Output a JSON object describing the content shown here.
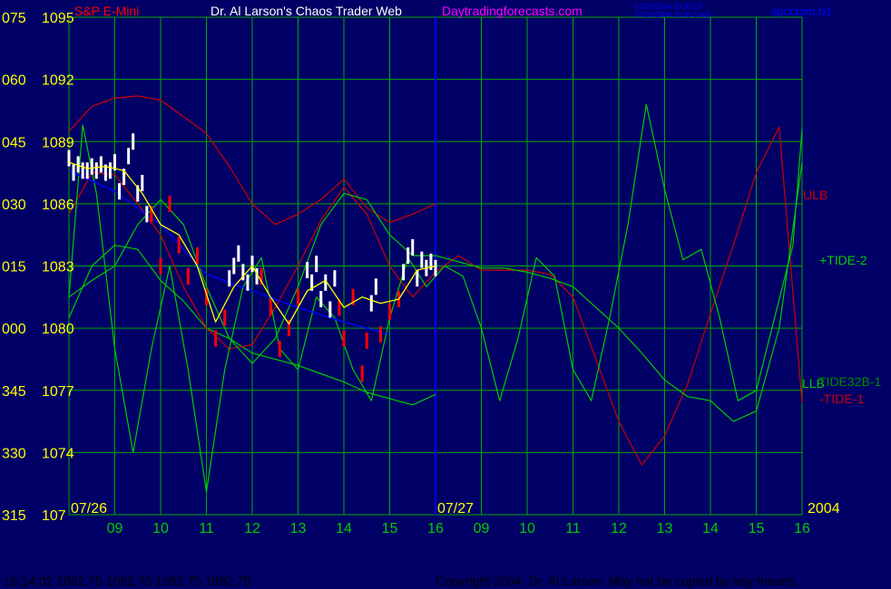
{
  "header": {
    "instrument": "S&P E-Mini",
    "publisher": "Dr. Al Larson's Chaos Trader Web",
    "website": "Daytradingforecasts.com",
    "timestamp_ut": "07/26/2004 20:30 UT",
    "timestamp_local": "07/26/2004 15:30 Local",
    "file_name": "spcctom.txt"
  },
  "footer": {
    "quote": "16:14:02  1082.75 1082.75 1082.75 1082.75",
    "copyright": "Copyright 2004, Dr. Al Larson. May not be copied by any means."
  },
  "colors": {
    "background": "#000066",
    "grid": "#00aa00",
    "price_up": "#ffffff",
    "price_down": "#ff0000",
    "average": "#ffff00",
    "trend": "#0000ff",
    "tide_green": "#00cc00",
    "tide_red": "#cc0000",
    "label_yellow": "#ffff00",
    "label_magenta": "#ff00ff",
    "label_blue": "#0000ff"
  },
  "chart_data": {
    "type": "line",
    "price_axis": {
      "ticks": [
        1071,
        1074,
        1077,
        1080,
        1083,
        1086,
        1089,
        1092,
        1095
      ],
      "labels": [
        "107",
        "1074",
        "1077",
        "1080",
        "1083",
        "1086",
        "1089",
        "1092",
        "1095"
      ],
      "range": [
        1071,
        1095
      ]
    },
    "angle_axis": {
      "labels": [
        "315",
        "330",
        "345",
        "000",
        "015",
        "030",
        "045",
        "060",
        "075"
      ]
    },
    "x_axis": {
      "hour_labels": [
        "09",
        "10",
        "11",
        "12",
        "13",
        "14",
        "15",
        "16",
        "09",
        "10",
        "11",
        "12",
        "13",
        "14",
        "15",
        "16"
      ],
      "date_labels": [
        "07/26",
        "07/27"
      ],
      "year_label": "2004",
      "range": [
        0,
        16
      ]
    },
    "grid": true,
    "series_labels": [
      "ULB",
      "+TIDE-2",
      "LLB",
      "TIDE32B-1",
      "-TIDE-1"
    ],
    "series": [
      {
        "key": "ulb",
        "x": [
          0,
          0.5,
          1,
          1.5,
          2,
          2.5,
          3,
          3.5,
          4,
          4.5,
          5,
          5.5,
          6,
          6.5,
          7,
          7.5,
          8
        ],
        "values": [
          1089.5,
          1090.7,
          1091.1,
          1091.2,
          1091,
          1090.2,
          1089.4,
          1087.8,
          1086,
          1085,
          1085.5,
          1086.2,
          1087.2,
          1085.8,
          1085.1,
          1085.5,
          1086
        ]
      },
      {
        "key": "llb",
        "x": [
          0,
          0.5,
          1,
          1.5,
          2,
          2.5,
          3,
          3.5,
          4,
          4.5,
          5,
          5.5,
          6,
          6.5,
          7,
          7.5,
          8
        ],
        "values": [
          1080.5,
          1083,
          1084,
          1083.8,
          1082.3,
          1081.3,
          1080,
          1079.5,
          1078.8,
          1078.5,
          1078.2,
          1077.8,
          1077.4,
          1076.9,
          1076.6,
          1076.3,
          1076.8
        ]
      },
      {
        "key": "tide_red",
        "x": [
          0,
          0.5,
          1,
          1.5,
          2,
          2.5,
          3,
          3.5,
          4,
          4.5,
          5,
          5.5,
          6,
          6.5,
          7,
          7.5,
          8,
          8.5,
          9,
          9.5,
          10,
          10.5,
          11,
          11.5,
          12,
          12.5,
          13,
          13.5,
          14,
          14.5,
          15,
          15.5,
          16
        ],
        "values": [
          1085.5,
          1087.5,
          1087.4,
          1086,
          1084.5,
          1082,
          1080,
          1079,
          1079.2,
          1081,
          1083,
          1085.2,
          1086.8,
          1085.5,
          1083,
          1081.5,
          1082.7,
          1083.5,
          1082.8,
          1082.8,
          1082.8,
          1082.6,
          1081.5,
          1078.5,
          1075.5,
          1073.4,
          1074.8,
          1077.3,
          1080.7,
          1084,
          1087.5,
          1089.7,
          1076.4
        ]
      },
      {
        "key": "tide_green",
        "x": [
          0,
          0.3,
          0.6,
          1,
          1.4,
          1.8,
          2.2,
          2.6,
          3,
          3.4,
          3.8,
          4.2,
          4.6,
          5,
          5.4,
          5.8,
          6.2,
          6.6,
          7,
          7.4,
          7.8,
          8.2,
          8.6,
          9,
          9.4,
          9.8,
          10.2,
          10.6,
          11,
          11.4,
          11.8,
          12.2,
          12.6,
          13,
          13.4,
          13.8,
          14.2,
          14.6,
          15,
          15.4,
          15.8,
          16
        ],
        "values": [
          1081.5,
          1089.8,
          1086.5,
          1079,
          1074,
          1079,
          1083,
          1078,
          1072.1,
          1078,
          1082,
          1083.4,
          1079,
          1078,
          1081.5,
          1080.5,
          1078,
          1076.5,
          1080.5,
          1083.4,
          1082,
          1083,
          1082.5,
          1080,
          1076.5,
          1079.5,
          1083.4,
          1082.5,
          1078,
          1076.5,
          1080.5,
          1085,
          1090.8,
          1086.7,
          1083.3,
          1083.8,
          1080.5,
          1076.5,
          1077,
          1080.5,
          1084,
          1089.6
        ]
      },
      {
        "key": "tide32",
        "x": [
          0,
          0.5,
          1,
          1.5,
          2,
          2.5,
          3,
          3.5,
          4,
          4.5,
          5,
          5.5,
          6,
          6.5,
          7,
          7.5,
          8,
          8.5,
          9,
          9.5,
          10,
          10.5,
          11,
          11.5,
          12,
          12.5,
          13,
          13.5,
          14,
          14.5,
          15,
          15.5,
          16
        ],
        "values": [
          1081.5,
          1082.3,
          1083,
          1085,
          1086.2,
          1085,
          1082,
          1079.5,
          1078.3,
          1079.5,
          1082,
          1085,
          1086.5,
          1086.2,
          1084.5,
          1083.5,
          1083.5,
          1083.2,
          1082.9,
          1082.9,
          1082.7,
          1082.4,
          1082,
          1081,
          1080,
          1078.8,
          1077.5,
          1076.7,
          1076.5,
          1075.5,
          1076,
          1080,
          1088
        ]
      },
      {
        "key": "trend",
        "x": [
          0,
          1,
          2,
          3,
          4,
          5,
          6,
          7
        ],
        "values": [
          1087.6,
          1086.6,
          1085,
          1082.6,
          1081.8,
          1081,
          1080.3,
          1079.7
        ]
      },
      {
        "key": "average",
        "x": [
          0,
          0.4,
          0.8,
          1.2,
          1.6,
          2,
          2.4,
          2.8,
          3.2,
          3.6,
          4,
          4.4,
          4.8,
          5.2,
          5.6,
          6,
          6.4,
          6.8,
          7.2,
          7.6,
          8
        ],
        "values": [
          1088,
          1087.7,
          1087.8,
          1087.6,
          1086.5,
          1085,
          1084.5,
          1083,
          1080.3,
          1082,
          1083,
          1081.5,
          1080.2,
          1081.8,
          1082.3,
          1081,
          1081.5,
          1081.2,
          1081.4,
          1082.8,
          1083
        ]
      },
      {
        "key": "price_white",
        "x": [
          0,
          0.1,
          0.2,
          0.3,
          0.4,
          0.5,
          0.6,
          0.7,
          0.8,
          0.9,
          1,
          1.1,
          1.2,
          1.3,
          1.4,
          1.5,
          1.6,
          1.7,
          3.5,
          3.6,
          3.7,
          3.8,
          3.9,
          4,
          4.1,
          5.2,
          5.3,
          5.4,
          5.5,
          5.6,
          5.7,
          5.8,
          6.6,
          6.7,
          7.3,
          7.4,
          7.5,
          7.6,
          7.7,
          7.8,
          7.9,
          8
        ],
        "values": [
          1088.2,
          1087.5,
          1087.9,
          1087.6,
          1087.6,
          1087.8,
          1087.6,
          1087.9,
          1087.5,
          1087.6,
          1088,
          1086.6,
          1087.3,
          1088.3,
          1089,
          1086.5,
          1087,
          1085.5,
          1082.4,
          1083,
          1083.6,
          1082.7,
          1082.2,
          1083.1,
          1082.5,
          1082.8,
          1082.2,
          1083.1,
          1081.4,
          1082.2,
          1080.9,
          1082.4,
          1081.2,
          1082,
          1082.7,
          1083.5,
          1083.9,
          1082.4,
          1083.3,
          1082.9,
          1083.2,
          1082.9
        ]
      },
      {
        "key": "price_red",
        "x": [
          1.8,
          2,
          2.2,
          2.4,
          2.6,
          2.8,
          3,
          3.2,
          3.4,
          4.2,
          4.4,
          4.6,
          4.8,
          5,
          5.9,
          6,
          6.2,
          6.4,
          6.5,
          6.8,
          7,
          7.2
        ],
        "values": [
          1085.5,
          1083,
          1086,
          1084,
          1082.5,
          1083.5,
          1081.5,
          1079.5,
          1080.5,
          1082.5,
          1081,
          1079,
          1080,
          1081.5,
          1081,
          1079.5,
          1081.5,
          1077.8,
          1079.4,
          1079.7,
          1080.8,
          1081.4
        ]
      }
    ]
  }
}
